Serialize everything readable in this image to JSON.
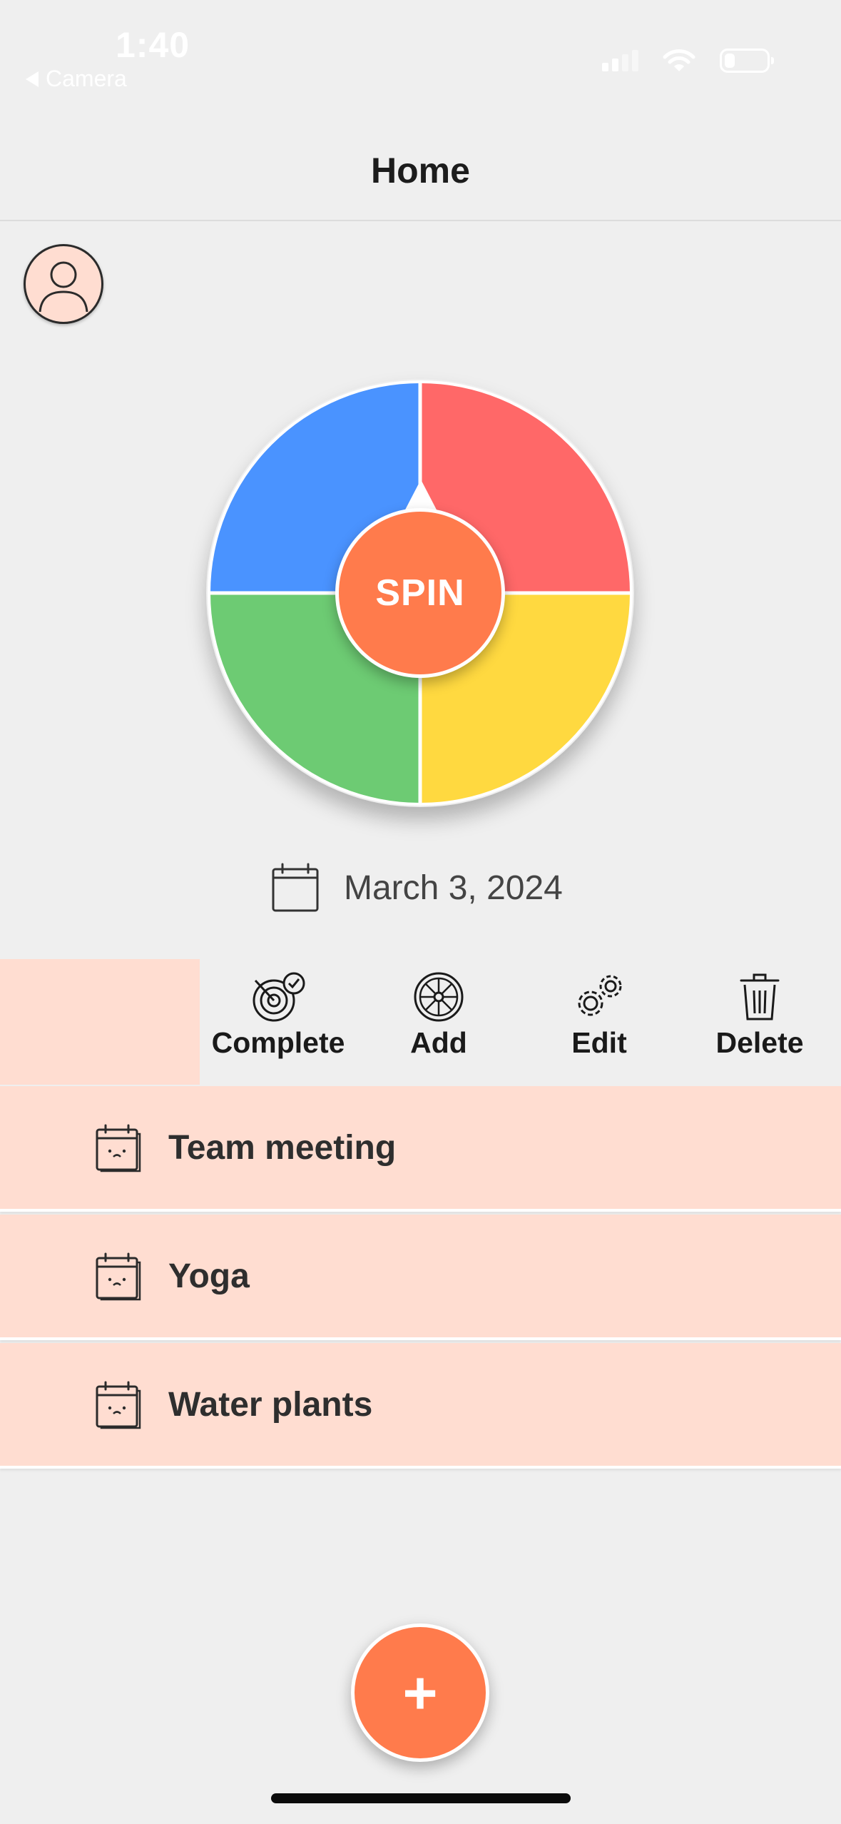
{
  "status_bar": {
    "time": "1:40",
    "back_label": "Camera"
  },
  "nav": {
    "title": "Home"
  },
  "wheel": {
    "spin_label": "SPIN",
    "segment_colors": [
      "#4a93ff",
      "#ff6868",
      "#ffd940",
      "#6dcb73"
    ]
  },
  "date": {
    "text": "March 3, 2024"
  },
  "actions": {
    "complete": "Complete",
    "add": "Add",
    "edit": "Edit",
    "delete": "Delete"
  },
  "tasks": [
    {
      "name": "Team meeting",
      "icon": "calendar-face-icon"
    },
    {
      "name": "Yoga",
      "icon": "calendar-face-icon"
    },
    {
      "name": "Water plants",
      "icon": "calendar-face-icon"
    }
  ],
  "fab": {
    "label": "+"
  },
  "colors": {
    "accent": "#ff7b4c",
    "row_background": "#ffddd1"
  }
}
